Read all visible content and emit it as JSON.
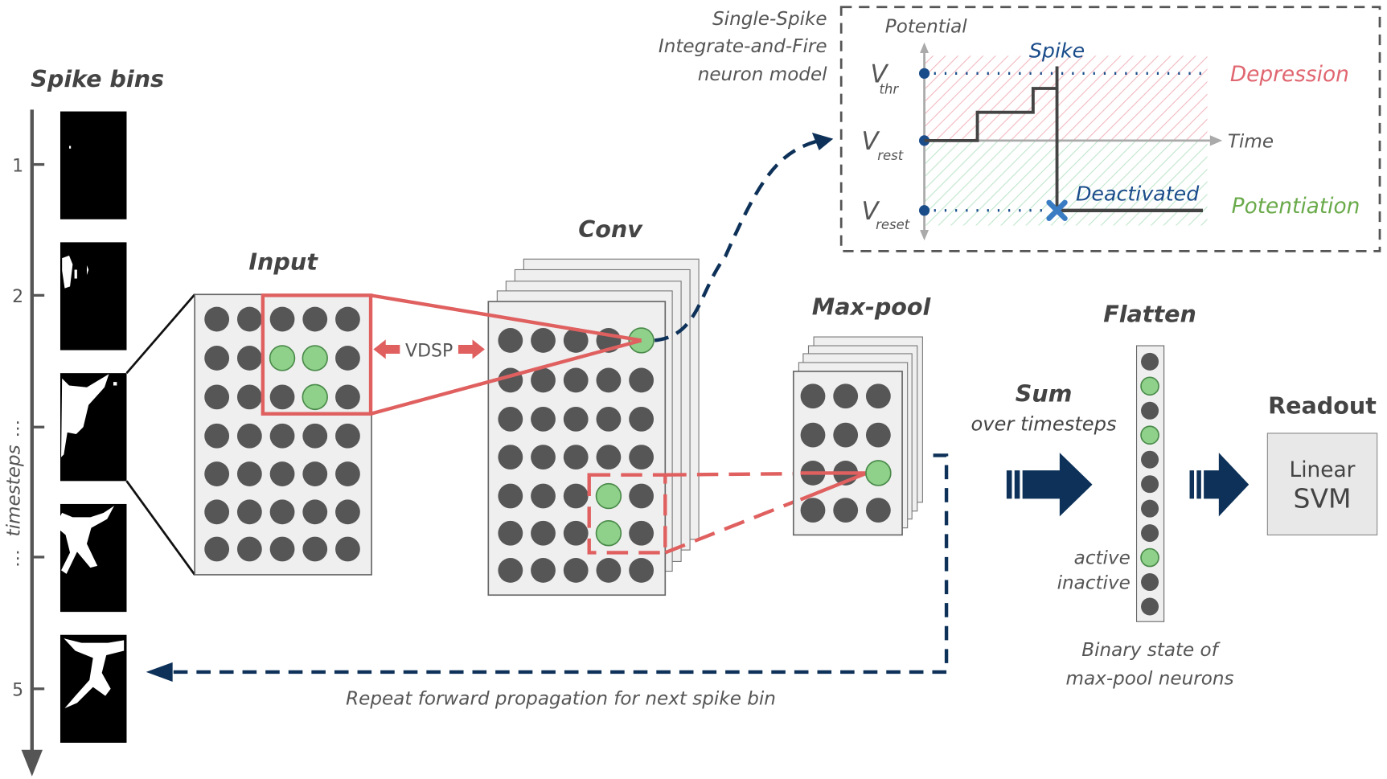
{
  "spike_bins": {
    "title": "Spike bins",
    "axis_label": "timesteps",
    "ticks": [
      "1",
      "2",
      "⋮",
      "⋮",
      "5"
    ]
  },
  "input": {
    "title": "Input",
    "rows": 7,
    "cols": 5,
    "active": [
      [
        1,
        2
      ],
      [
        1,
        3
      ],
      [
        2,
        3
      ]
    ]
  },
  "vdsp_label": "VDSP",
  "conv": {
    "title": "Conv",
    "rows": 7,
    "cols": 5,
    "active": [
      [
        0,
        4
      ],
      [
        4,
        3
      ],
      [
        5,
        3
      ]
    ]
  },
  "maxpool": {
    "title": "Max-pool",
    "rows": 4,
    "cols": 3,
    "active": [
      [
        2,
        2
      ]
    ]
  },
  "flatten": {
    "title": "Flatten",
    "states": [
      0,
      1,
      0,
      1,
      0,
      0,
      0,
      0,
      1,
      0,
      0
    ],
    "active_label": "active",
    "inactive_label": "inactive",
    "caption_line1": "Binary state of",
    "caption_line2": "max-pool neurons"
  },
  "sum": {
    "line1": "Sum",
    "line2": "over timesteps"
  },
  "readout": {
    "title": "Readout",
    "line1": "Linear",
    "line2": "SVM"
  },
  "feedback_label": "Repeat forward propagation for next spike bin",
  "neuron_model": {
    "title_line1": "Single-Spike",
    "title_line2": "Integrate-and-Fire",
    "title_line3": "neuron model",
    "y_axis": "Potential",
    "x_axis": "Time",
    "v_thr": {
      "main": "V",
      "sub": "thr"
    },
    "v_rest": {
      "main": "V",
      "sub": "rest"
    },
    "v_reset": {
      "main": "V",
      "sub": "reset"
    },
    "spike_label": "Spike",
    "deactivated_label": "Deactivated",
    "depression_label": "Depression",
    "potentiation_label": "Potentiation"
  },
  "colors": {
    "navy": "#0d3158",
    "red": "#e06060",
    "green": "#8fd18a",
    "neuron": "#565656",
    "depression": "#e06670",
    "potentiation": "#6aaa4a"
  }
}
